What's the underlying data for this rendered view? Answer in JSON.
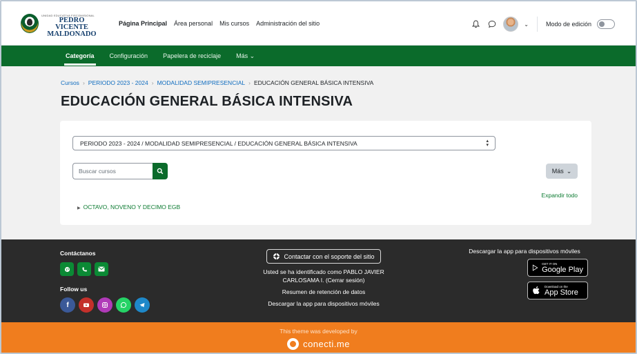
{
  "logo": {
    "tagline": "UNIDAD EDUCATIVA FISCOMISIONAL",
    "line1": "PEDRO VICENTE",
    "line2": "MALDONADO"
  },
  "nav": {
    "items": [
      "Página Principal",
      "Área personal",
      "Mis cursos",
      "Administración del sitio"
    ],
    "edit_mode_label": "Modo de edición"
  },
  "secondary_nav": {
    "items": [
      "Categoría",
      "Configuración",
      "Papelera de reciclaje",
      "Más"
    ]
  },
  "breadcrumb": [
    "Cursos",
    "PERIODO 2023 - 2024",
    "MODALIDAD SEMIPRESENCIAL",
    "EDUCACIÓN GENERAL BÁSICA INTENSIVA"
  ],
  "page_title": "EDUCACIÓN GENERAL BÁSICA INTENSIVA",
  "category_select": {
    "value": "PERIODO 2023 - 2024 / MODALIDAD SEMIPRESENCIAL / EDUCACIÓN GENERAL BÁSICA INTENSIVA"
  },
  "search": {
    "placeholder": "Buscar cursos"
  },
  "more_button": "Más",
  "expand_all": "Expandir todo",
  "subcategory": "OCTAVO, NOVENO Y DECIMO EGB",
  "footer": {
    "contact_title": "Contáctanos",
    "follow_title": "Follow us",
    "support_button": "Contactar con el soporte del sitio",
    "logged_in_text": "Usted se ha identificado como PABLO JAVIER CARLOSAMA I. (Cerrar sesión)",
    "data_retention": "Resumen de retención de datos",
    "get_app": "Descargar la app para dispositivos móviles",
    "app_title": "Descargar la app para dispositivos móviles",
    "google_small": "GET IT ON",
    "google_big": "Google Play",
    "apple_small": "Download on the",
    "apple_big": "App Store"
  },
  "developer": {
    "text": "This theme was developed by",
    "brand": "conecti.me"
  },
  "colors": {
    "green": "#0b6b2b",
    "orange": "#f07d1e",
    "footer_bg": "#2b2b2b"
  }
}
